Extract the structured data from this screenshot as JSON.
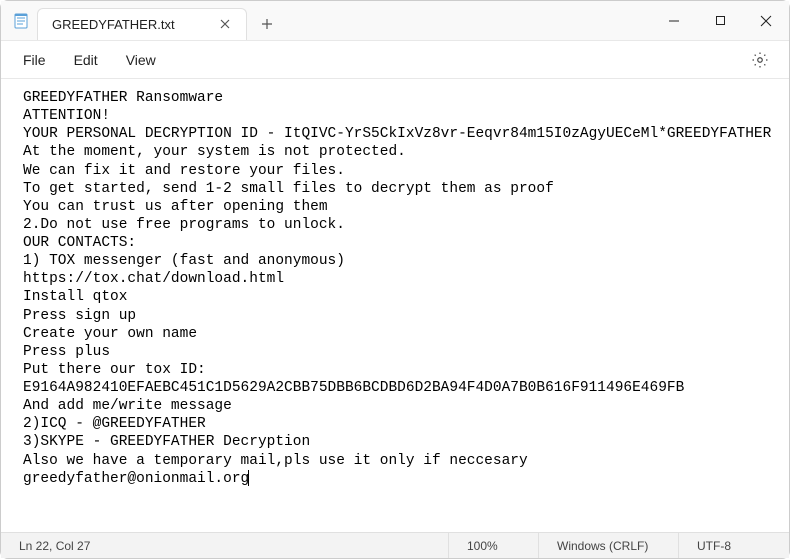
{
  "window": {
    "tab_title": "GREEDYFATHER.txt"
  },
  "menu": {
    "file": "File",
    "edit": "Edit",
    "view": "View"
  },
  "content": {
    "lines": [
      "GREEDYFATHER Ransomware",
      "ATTENTION!",
      "YOUR PERSONAL DECRYPTION ID - ItQIVC-YrS5CkIxVz8vr-Eeqvr84m15I0zAgyUECeMl*GREEDYFATHER",
      "At the moment, your system is not protected.",
      "We can fix it and restore your files.",
      "To get started, send 1-2 small files to decrypt them as proof",
      "You can trust us after opening them",
      "2.Do not use free programs to unlock.",
      "OUR CONTACTS:",
      "1) TOX messenger (fast and anonymous)",
      "https://tox.chat/download.html",
      "Install qtox",
      "Press sign up",
      "Create your own name",
      "Press plus",
      "Put there our tox ID:",
      "E9164A982410EFAEBC451C1D5629A2CBB75DBB6BCDBD6D2BA94F4D0A7B0B616F911496E469FB",
      "And add me/write message",
      "2)ICQ - @GREEDYFATHER",
      "3)SKYPE - GREEDYFATHER Decryption",
      "Also we have a temporary mail,pls use it only if neccesary",
      "greedyfather@onionmail.org"
    ]
  },
  "status": {
    "position": "Ln 22, Col 27",
    "zoom": "100%",
    "line_ending": "Windows (CRLF)",
    "encoding": "UTF-8"
  }
}
